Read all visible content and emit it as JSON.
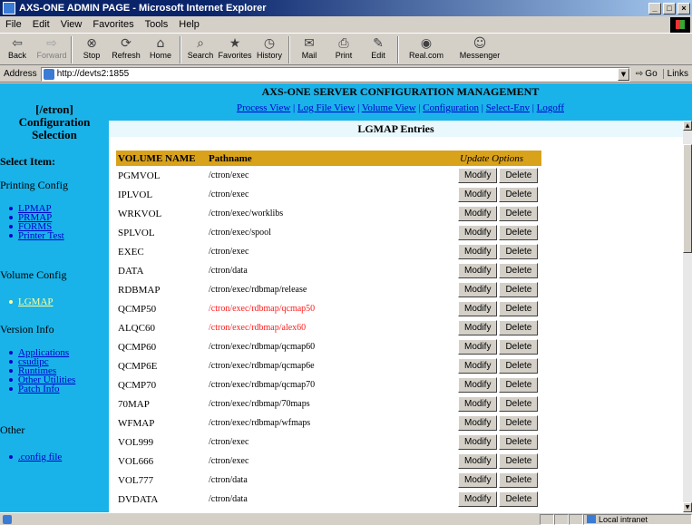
{
  "window": {
    "title": "AXS-ONE ADMIN PAGE - Microsoft Internet Explorer",
    "buttons": [
      "_",
      "□",
      "×"
    ]
  },
  "menu": [
    "File",
    "Edit",
    "View",
    "Favorites",
    "Tools",
    "Help"
  ],
  "toolbar": [
    {
      "label": "Back",
      "icon": "back-arrow-icon",
      "glyph": "⇦",
      "disabled": false
    },
    {
      "label": "Forward",
      "icon": "forward-arrow-icon",
      "glyph": "⇨",
      "disabled": true
    },
    {
      "label": "Stop",
      "icon": "stop-icon",
      "glyph": "⊗",
      "disabled": false
    },
    {
      "label": "Refresh",
      "icon": "refresh-icon",
      "glyph": "⟳",
      "disabled": false
    },
    {
      "label": "Home",
      "icon": "home-icon",
      "glyph": "⌂",
      "disabled": false
    },
    {
      "label": "Search",
      "icon": "search-icon",
      "glyph": "⌕",
      "disabled": false
    },
    {
      "label": "Favorites",
      "icon": "favorites-icon",
      "glyph": "★",
      "disabled": false
    },
    {
      "label": "History",
      "icon": "history-icon",
      "glyph": "◷",
      "disabled": false
    },
    {
      "label": "Mail",
      "icon": "mail-icon",
      "glyph": "✉",
      "disabled": false
    },
    {
      "label": "Print",
      "icon": "print-icon",
      "glyph": "⎙",
      "disabled": false
    },
    {
      "label": "Edit",
      "icon": "edit-icon",
      "glyph": "✎",
      "disabled": false
    },
    {
      "label": "Real.com",
      "icon": "realcom-icon",
      "glyph": "◉",
      "disabled": false
    },
    {
      "label": "Messenger",
      "icon": "messenger-icon",
      "glyph": "☺",
      "disabled": false
    }
  ],
  "address": {
    "label": "Address",
    "url": "http://devts2:1855",
    "go": "Go",
    "links": "Links"
  },
  "sidebar": {
    "org": "[/etron]",
    "title_line1": "Configuration",
    "title_line2": "Selection",
    "select_item": "Select Item:",
    "printing_config": "Printing Config",
    "printing_links": [
      "LPMAP",
      "PRMAP",
      "FORMS",
      "Printer Test"
    ],
    "volume_config": "Volume Config",
    "volume_links": [
      "LGMAP"
    ],
    "version_info": "Version Info",
    "version_links": [
      "Applications",
      "csudipc",
      "Runtimes",
      "Other Utilities",
      "Patch Info"
    ],
    "other": "Other",
    "other_links": [
      ".config file"
    ]
  },
  "header": {
    "title": "AXS-ONE SERVER CONFIGURATION MANAGEMENT",
    "nav": [
      "Process View",
      "Log File View",
      "Volume View",
      "Configuration",
      "Select-Env",
      "Logoff"
    ]
  },
  "content": {
    "heading": "LGMAP Entries",
    "columns": {
      "volume": "VOLUME NAME",
      "path": "Pathname",
      "update": "Update Options"
    },
    "modify_label": "Modify",
    "delete_label": "Delete",
    "rows": [
      {
        "volume": "PGMVOL",
        "path": "/ctron/exec",
        "highlight": false
      },
      {
        "volume": "IPLVOL",
        "path": "/ctron/exec",
        "highlight": false
      },
      {
        "volume": "WRKVOL",
        "path": "/ctron/exec/worklibs",
        "highlight": false
      },
      {
        "volume": "SPLVOL",
        "path": "/ctron/exec/spool",
        "highlight": false
      },
      {
        "volume": "EXEC",
        "path": "/ctron/exec",
        "highlight": false
      },
      {
        "volume": "DATA",
        "path": "/ctron/data",
        "highlight": false
      },
      {
        "volume": "RDBMAP",
        "path": "/ctron/exec/rdbmap/release",
        "highlight": false
      },
      {
        "volume": "QCMP50",
        "path": "/ctron/exec/rdbmap/qcmap50",
        "highlight": true
      },
      {
        "volume": "ALQC60",
        "path": "/ctron/exec/rdbmap/alex60",
        "highlight": true
      },
      {
        "volume": "QCMP60",
        "path": "/ctron/exec/rdbmap/qcmap60",
        "highlight": false
      },
      {
        "volume": "QCMP6E",
        "path": "/ctron/exec/rdbmap/qcmap6e",
        "highlight": false
      },
      {
        "volume": "QCMP70",
        "path": "/ctron/exec/rdbmap/qcmap70",
        "highlight": false
      },
      {
        "volume": "70MAP",
        "path": "/ctron/exec/rdbmap/70maps",
        "highlight": false
      },
      {
        "volume": "WFMAP",
        "path": "/ctron/exec/rdbmap/wfmaps",
        "highlight": false
      },
      {
        "volume": "VOL999",
        "path": "/ctron/exec",
        "highlight": false
      },
      {
        "volume": "VOL666",
        "path": "/ctron/exec",
        "highlight": false
      },
      {
        "volume": "VOL777",
        "path": "/ctron/data",
        "highlight": false
      },
      {
        "volume": "DVDATA",
        "path": "/ctron/data",
        "highlight": false
      }
    ]
  },
  "status": {
    "zone": "Local intranet"
  },
  "colors": {
    "page_bg": "#19b3e9",
    "table_header": "#d9a21b",
    "highlight_text": "#ff1a1a",
    "link": "#0000cc",
    "active_link": "#ffff99"
  }
}
